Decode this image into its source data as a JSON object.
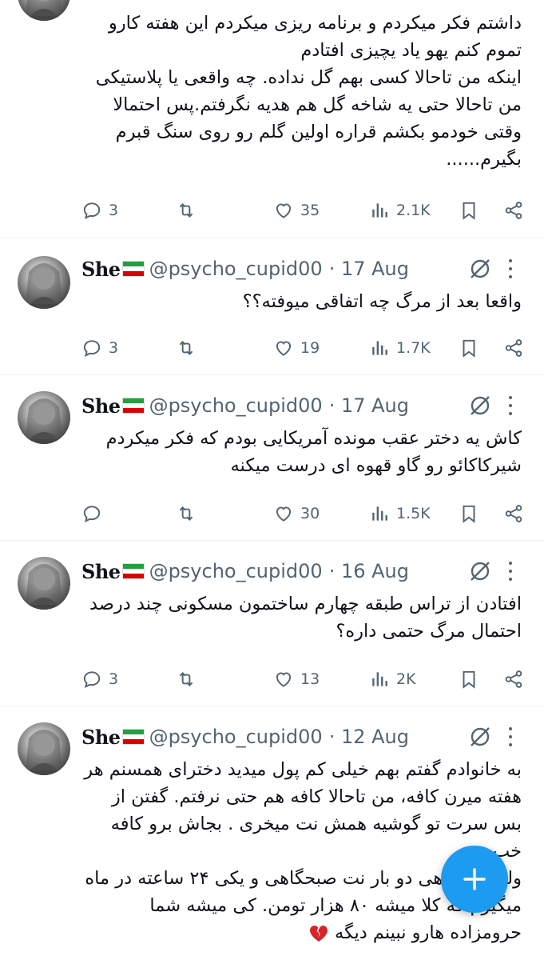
{
  "colors": {
    "accent": "#1d9bf0",
    "muted": "#536471",
    "text": "#0f1419"
  },
  "feed": {
    "tweets": [
      {
        "text": "داشتم فکر میکردم و برنامه ریزی میکردم این هفته کارو تموم کنم یهو یاد یچیزی افتادم\nاینکه من تاحالا کسی بهم گل نداده. چه واقعی یا پلاستیکی من تاحالا حتی یه شاخه گل هم هدیه نگرفتم.پس احتمالا وقتی خودمو بکشم قراره اولین گلم رو روی سنگ قبرم بگیرم......",
        "replies": "3",
        "likes": "35",
        "views": "2.1K"
      },
      {
        "name": "She",
        "handle": "@psycho_cupid00",
        "date": "· 17 Aug",
        "text": "واقعا بعد از مرگ چه اتفاقی میوفته؟؟",
        "replies": "3",
        "likes": "19",
        "views": "1.7K"
      },
      {
        "name": "She",
        "handle": "@psycho_cupid00",
        "date": "· 17 Aug",
        "text": "کاش یه دختر عقب مونده آمریکایی بودم که فکر میکردم شیرکاکائو رو گاو قهوه ای درست میکنه",
        "replies": "",
        "likes": "30",
        "views": "1.5K"
      },
      {
        "name": "She",
        "handle": "@psycho_cupid00",
        "date": "· 16 Aug",
        "text": "افتادن از تراس طبقه چهارم ساختمون مسکونی چند درصد احتمال مرگ حتمی داره؟",
        "replies": "3",
        "likes": "13",
        "views": "2K"
      },
      {
        "name": "She",
        "handle": "@psycho_cupid00",
        "date": "· 12 Aug",
        "text": "به خانوادم گفتم بهم خیلی کم پول میدید دخترای همسنم هر هفته میرن کافه، من تاحالا کافه هم حتی نرفتم. گفتن از بس سرت تو گوشیه همش نت میخری . بجاش برو کافه خب\nولی من ماهی دو بار نت صبحگاهی و یکی ۲۴ ساعته در ماه میگیرم که کلا میشه ۸۰ هزار تومن. کی میشه شما حرومزاده هارو نبینم دیگه"
      }
    ]
  },
  "icons": {
    "reply": "reply-bubble-icon",
    "retweet": "retweet-icon",
    "like": "heart-icon",
    "views": "analytics-bars-icon",
    "bookmark": "bookmark-icon",
    "share": "share-icon",
    "grok": "grok-slash-icon",
    "more": "more-dots-icon",
    "compose": "plus-icon",
    "flag": "iran-flag-icon",
    "broken_heart": "broken-heart-emoji-icon"
  }
}
